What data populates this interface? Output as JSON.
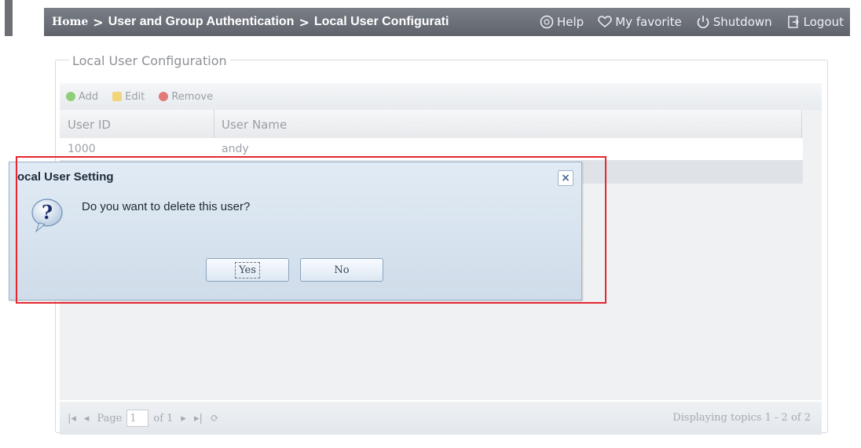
{
  "header": {
    "home": "Home",
    "sep1": ">",
    "crumb1": "User and Group Authentication",
    "sep2": ">",
    "crumb2": "Local User Configurati",
    "help": "Help",
    "favorite": "My favorite",
    "shutdown": "Shutdown",
    "logout": "Logout"
  },
  "panel": {
    "title": "Local User Configuration",
    "toolbar": {
      "add": "Add",
      "edit": "Edit",
      "remove": "Remove"
    },
    "columns": [
      "User ID",
      "User Name"
    ],
    "rows": [
      {
        "id": "1000",
        "name": "andy"
      },
      {
        "id": "",
        "name": ""
      }
    ],
    "pager": {
      "page_label": "Page",
      "page_value": "1",
      "of_label": "of 1",
      "display": "Displaying topics 1 - 2 of 2"
    }
  },
  "dialog": {
    "title": "ocal User Setting",
    "message": "Do you want to delete this user?",
    "yes": "Yes",
    "no": "No",
    "close": "×"
  },
  "colors": {
    "highlight": "#e5262f",
    "header_bg": "#6a6e76",
    "dialog_bg": "#d9e4ef"
  }
}
